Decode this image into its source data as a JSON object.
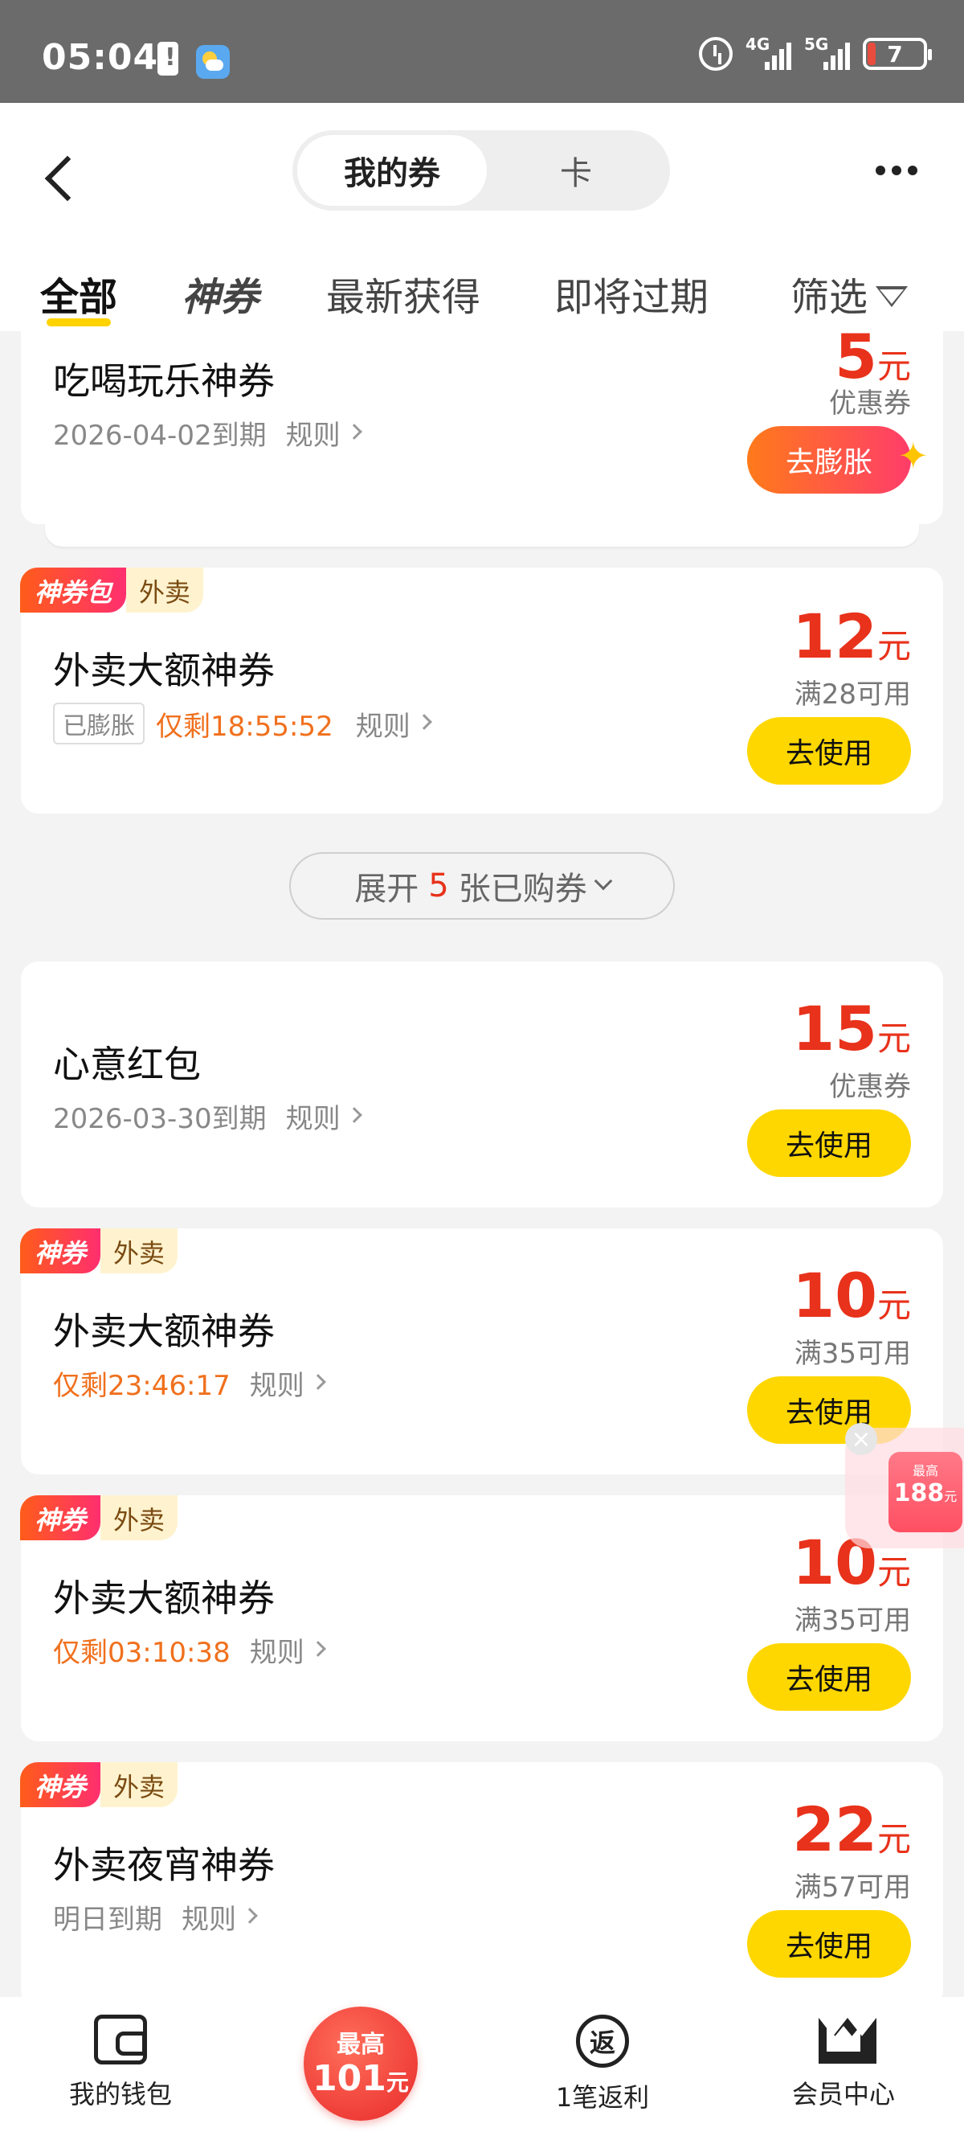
{
  "status_bar": {
    "time": "05:04",
    "net1": "4G",
    "net2": "5G",
    "battery": "7"
  },
  "header": {
    "segment": {
      "active": "我的券",
      "inactive": "卡"
    },
    "tabs": [
      "全部",
      "神券",
      "最新获得",
      "即将过期",
      "筛选"
    ]
  },
  "cards": [
    {
      "title": "吃喝玩乐神券",
      "expiry": "2026-04-02到期",
      "rule": "规则",
      "amount": "5",
      "unit": "元",
      "condition": "优惠券",
      "button": "去膨胀"
    },
    {
      "tag_hot": "神券包",
      "tag_cat": "外卖",
      "title": "外卖大额神券",
      "badge": "已膨胀",
      "countdown": "仅剩18:55:52",
      "rule": "规则",
      "amount": "12",
      "unit": "元",
      "condition": "满28可用",
      "button": "去使用"
    },
    {
      "title": "心意红包",
      "expiry": "2026-03-30到期",
      "rule": "规则",
      "amount": "15",
      "unit": "元",
      "condition": "优惠券",
      "button": "去使用"
    },
    {
      "tag_hot": "神券",
      "tag_cat": "外卖",
      "title": "外卖大额神券",
      "countdown": "仅剩23:46:17",
      "rule": "规则",
      "amount": "10",
      "unit": "元",
      "condition": "满35可用",
      "button": "去使用"
    },
    {
      "tag_hot": "神券",
      "tag_cat": "外卖",
      "title": "外卖大额神券",
      "countdown": "仅剩03:10:38",
      "rule": "规则",
      "amount": "10",
      "unit": "元",
      "condition": "满35可用",
      "button": "去使用"
    },
    {
      "tag_hot": "神券",
      "tag_cat": "外卖",
      "title": "外卖夜宵神券",
      "expiry": "明日到期",
      "rule": "规则",
      "amount": "22",
      "unit": "元",
      "condition": "满57可用",
      "button": "去使用"
    }
  ],
  "expand": {
    "prefix": "展开",
    "count": "5",
    "suffix": "张已购券"
  },
  "float_widget": {
    "small": "最高",
    "big": "188",
    "unit": "元"
  },
  "bottom_nav": {
    "wallet": "我的钱包",
    "promo_top": "最高",
    "promo_amount": "101",
    "promo_unit": "元",
    "rebate": "1笔返利",
    "rebate_icon_char": "返",
    "member": "会员中心"
  }
}
